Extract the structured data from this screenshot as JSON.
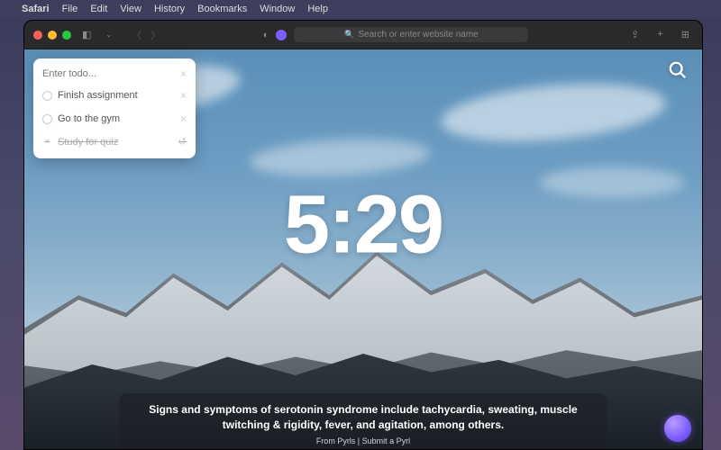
{
  "menubar": {
    "app": "Safari",
    "items": [
      "File",
      "Edit",
      "View",
      "History",
      "Bookmarks",
      "Window",
      "Help"
    ]
  },
  "toolbar": {
    "address_placeholder": "Search or enter website name"
  },
  "todo": {
    "placeholder": "Enter todo...",
    "items": [
      {
        "text": "Finish assignment",
        "done": false
      },
      {
        "text": "Go to the gym",
        "done": false
      },
      {
        "text": "Study for quiz",
        "done": true
      }
    ]
  },
  "clock": {
    "time": "5:29"
  },
  "fact": {
    "text": "Signs and symptoms of serotonin syndrome include tachycardia, sweating, muscle twitching & rigidity, fever, and agitation, among others.",
    "source": "From Pyrls | Submit a Pyrl"
  }
}
